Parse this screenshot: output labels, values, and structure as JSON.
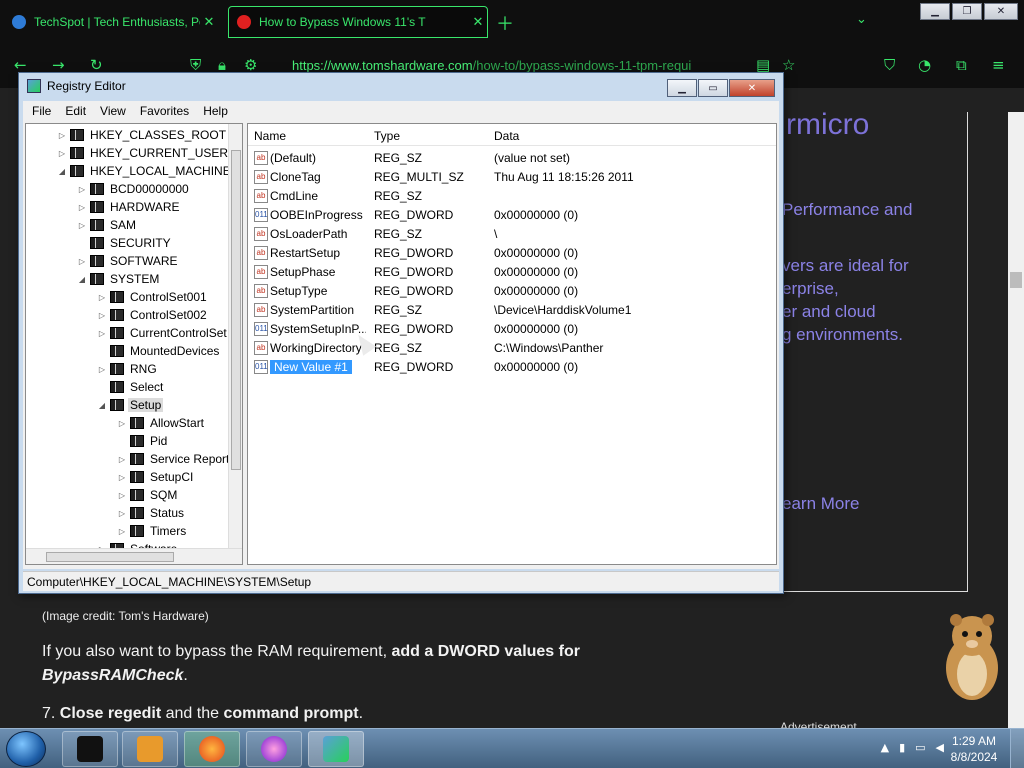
{
  "browser": {
    "tabs": [
      {
        "title": "TechSpot | Tech Enthusiasts, Po",
        "close": "✕"
      },
      {
        "title": "How to Bypass Windows 11's T",
        "close": "✕"
      }
    ],
    "url_domain": "https://www.tomshardware.com",
    "url_path": "/how-to/bypass-windows-11-tpm-requi",
    "window_buttons": {
      "min": "▁",
      "max": "❐",
      "close": "✕"
    }
  },
  "page": {
    "ad": {
      "brand": "rmicro",
      "lines": [
        "Performance and",
        "vers are ideal for",
        "erprise,",
        "er and cloud",
        "g environments."
      ],
      "learn_more": "earn More"
    },
    "caption": "(Image credit: Tom's Hardware)",
    "para_plain": "If you also want to bypass the RAM requirement, ",
    "para_bold": "add a DWORD values for ",
    "para_italic": "BypassRAMCheck",
    "para_end": ".",
    "step_num": "7. ",
    "step_b1": "Close regedit",
    "step_mid": " and the ",
    "step_b2": "command prompt",
    "step_end": ".",
    "advert_label": "Advertisement"
  },
  "regedit": {
    "title": "Registry Editor",
    "menu": [
      "File",
      "Edit",
      "View",
      "Favorites",
      "Help"
    ],
    "tree": [
      {
        "label": "HKEY_CLASSES_ROOT",
        "exp": "▷"
      },
      {
        "label": "HKEY_CURRENT_USER",
        "exp": "▷"
      },
      {
        "label": "HKEY_LOCAL_MACHINE",
        "exp": "◢"
      },
      {
        "label": "BCD00000000",
        "exp": "▷"
      },
      {
        "label": "HARDWARE",
        "exp": "▷"
      },
      {
        "label": "SAM",
        "exp": "▷"
      },
      {
        "label": "SECURITY",
        "exp": ""
      },
      {
        "label": "SOFTWARE",
        "exp": "▷"
      },
      {
        "label": "SYSTEM",
        "exp": "◢"
      },
      {
        "label": "ControlSet001",
        "exp": "▷"
      },
      {
        "label": "ControlSet002",
        "exp": "▷"
      },
      {
        "label": "CurrentControlSet",
        "exp": "▷"
      },
      {
        "label": "MountedDevices",
        "exp": ""
      },
      {
        "label": "RNG",
        "exp": "▷"
      },
      {
        "label": "Select",
        "exp": ""
      },
      {
        "label": "Setup",
        "exp": "◢"
      },
      {
        "label": "AllowStart",
        "exp": "▷"
      },
      {
        "label": "Pid",
        "exp": ""
      },
      {
        "label": "Service Report",
        "exp": "▷"
      },
      {
        "label": "SetupCI",
        "exp": "▷"
      },
      {
        "label": "SQM",
        "exp": "▷"
      },
      {
        "label": "Status",
        "exp": "▷"
      },
      {
        "label": "Timers",
        "exp": "▷"
      },
      {
        "label": "Software",
        "exp": "▷"
      }
    ],
    "columns": {
      "name": "Name",
      "type": "Type",
      "data": "Data"
    },
    "values": [
      {
        "icon": "ab",
        "name": "(Default)",
        "type": "REG_SZ",
        "data": "(value not set)"
      },
      {
        "icon": "ab",
        "name": "CloneTag",
        "type": "REG_MULTI_SZ",
        "data": "Thu Aug 11 18:15:26 2011"
      },
      {
        "icon": "ab",
        "name": "CmdLine",
        "type": "REG_SZ",
        "data": ""
      },
      {
        "icon": "011",
        "name": "OOBEInProgress",
        "type": "REG_DWORD",
        "data": "0x00000000 (0)"
      },
      {
        "icon": "ab",
        "name": "OsLoaderPath",
        "type": "REG_SZ",
        "data": "\\"
      },
      {
        "icon": "ab",
        "name": "RestartSetup",
        "type": "REG_DWORD",
        "data": "0x00000000 (0)"
      },
      {
        "icon": "ab",
        "name": "SetupPhase",
        "type": "REG_DWORD",
        "data": "0x00000000 (0)"
      },
      {
        "icon": "ab",
        "name": "SetupType",
        "type": "REG_DWORD",
        "data": "0x00000000 (0)"
      },
      {
        "icon": "ab",
        "name": "SystemPartition",
        "type": "REG_SZ",
        "data": "\\Device\\HarddiskVolume1"
      },
      {
        "icon": "011",
        "name": "SystemSetupInP...",
        "type": "REG_DWORD",
        "data": "0x00000000 (0)"
      },
      {
        "icon": "ab",
        "name": "WorkingDirectory",
        "type": "REG_SZ",
        "data": "C:\\Windows\\Panther"
      },
      {
        "icon": "011",
        "name": "New Value #1",
        "type": "REG_DWORD",
        "data": "0x00000000 (0)"
      }
    ],
    "status": "Computer\\HKEY_LOCAL_MACHINE\\SYSTEM\\Setup"
  },
  "taskbar": {
    "time": "1:29 AM",
    "date": "8/8/2024"
  }
}
